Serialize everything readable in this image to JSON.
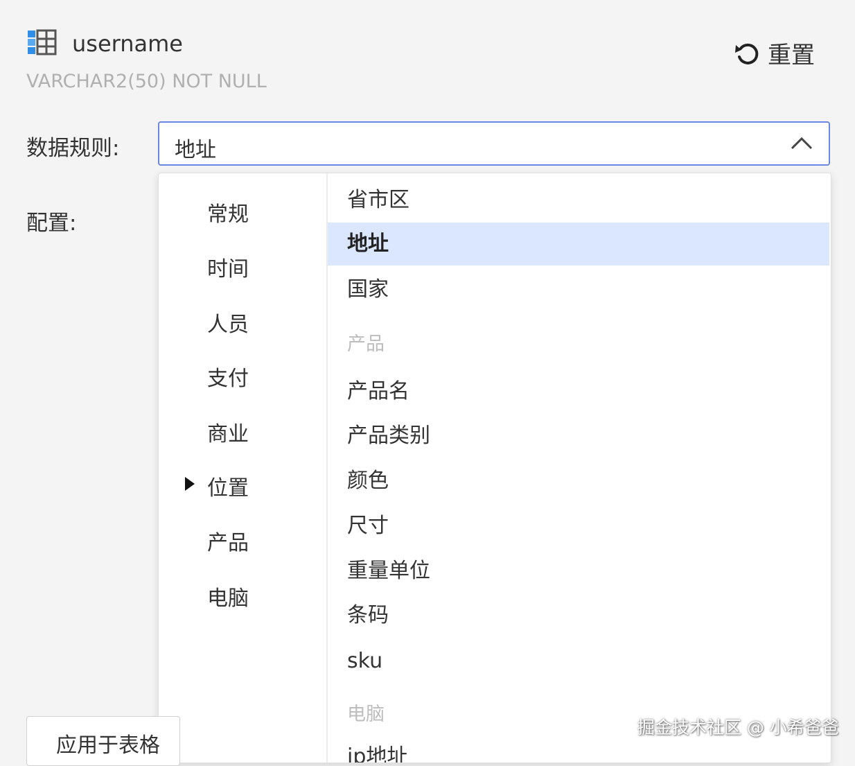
{
  "field": {
    "name": "username",
    "type": "VARCHAR2(50) NOT NULL",
    "icon": "table-icon"
  },
  "reset": {
    "label": "重置",
    "icon": "refresh-icon"
  },
  "form": {
    "rule_label": "数据规则:",
    "config_label": "配置:"
  },
  "select": {
    "value": "地址",
    "icon": "chevron-up-icon"
  },
  "dropdown": {
    "categories": [
      "常规",
      "时间",
      "人员",
      "支付",
      "商业",
      "位置",
      "产品",
      "电脑"
    ],
    "active_category": "位置",
    "options": [
      {
        "label": "省市区"
      },
      {
        "label": "地址",
        "selected": true
      },
      {
        "label": "国家"
      },
      {
        "group": "产品"
      },
      {
        "label": "产品名"
      },
      {
        "label": "产品类别"
      },
      {
        "label": "颜色"
      },
      {
        "label": "尺寸"
      },
      {
        "label": "重量单位"
      },
      {
        "label": "条码"
      },
      {
        "label": "sku"
      },
      {
        "group": "电脑"
      },
      {
        "label": "ip地址"
      }
    ]
  },
  "apply_button": {
    "label": "应用于表格"
  },
  "watermark": "掘金技术社区 @ 小希爸爸",
  "colors": {
    "accent": "#6a86e6",
    "selected_bg": "#dbe6ff",
    "background": "#f4f4f4"
  }
}
